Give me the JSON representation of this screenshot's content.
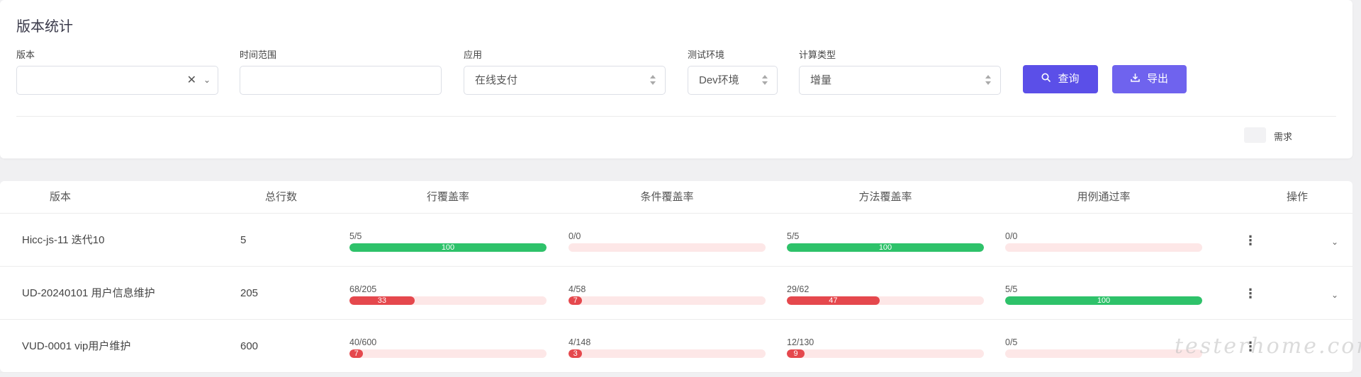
{
  "page_title": "版本统计",
  "filters": {
    "version": {
      "label": "版本",
      "value": "",
      "clear": "✕",
      "chevron": "⌄"
    },
    "time_range": {
      "label": "时间范围",
      "value": ""
    },
    "app": {
      "label": "应用",
      "value": "在线支付"
    },
    "env": {
      "label": "测试环境",
      "value": "Dev环境"
    },
    "calc_type": {
      "label": "计算类型",
      "value": "增量"
    }
  },
  "buttons": {
    "query": {
      "label": "查询",
      "icon": "search-icon"
    },
    "export": {
      "label": "导出",
      "icon": "download-icon"
    }
  },
  "legend": {
    "label": "需求"
  },
  "table": {
    "headers": {
      "version": "版本",
      "total": "总行数",
      "line_cov": "行覆盖率",
      "cond_cov": "条件覆盖率",
      "method_cov": "方法覆盖率",
      "case_pass": "用例通过率",
      "actions": "操作"
    },
    "rows": [
      {
        "version": "Hicc-js-11 迭代10",
        "total": "5",
        "line": {
          "frac": "5/5",
          "pct": 100,
          "label": "100"
        },
        "cond": {
          "frac": "0/0",
          "pct": 0,
          "label": ""
        },
        "method": {
          "frac": "5/5",
          "pct": 100,
          "label": "100"
        },
        "case": {
          "frac": "0/0",
          "pct": 0,
          "label": ""
        }
      },
      {
        "version": "UD-20240101 用户信息维护",
        "total": "205",
        "line": {
          "frac": "68/205",
          "pct": 33,
          "label": "33"
        },
        "cond": {
          "frac": "4/58",
          "pct": 7,
          "label": "7"
        },
        "method": {
          "frac": "29/62",
          "pct": 47,
          "label": "47"
        },
        "case": {
          "frac": "5/5",
          "pct": 100,
          "label": "100"
        }
      },
      {
        "version": "VUD-0001 vip用户维护",
        "total": "600",
        "line": {
          "frac": "40/600",
          "pct": 7,
          "label": "7"
        },
        "cond": {
          "frac": "4/148",
          "pct": 3,
          "label": "3"
        },
        "method": {
          "frac": "12/130",
          "pct": 9,
          "label": "9"
        },
        "case": {
          "frac": "0/5",
          "pct": 0,
          "label": ""
        }
      }
    ],
    "menu_glyph": "⋮",
    "expand_glyph": "⌄"
  },
  "colors": {
    "primary": "#5b4fe8",
    "good": "#2ec26a",
    "bad": "#e5484d",
    "track": "#fde7e7"
  },
  "watermark": "testerhome.com"
}
